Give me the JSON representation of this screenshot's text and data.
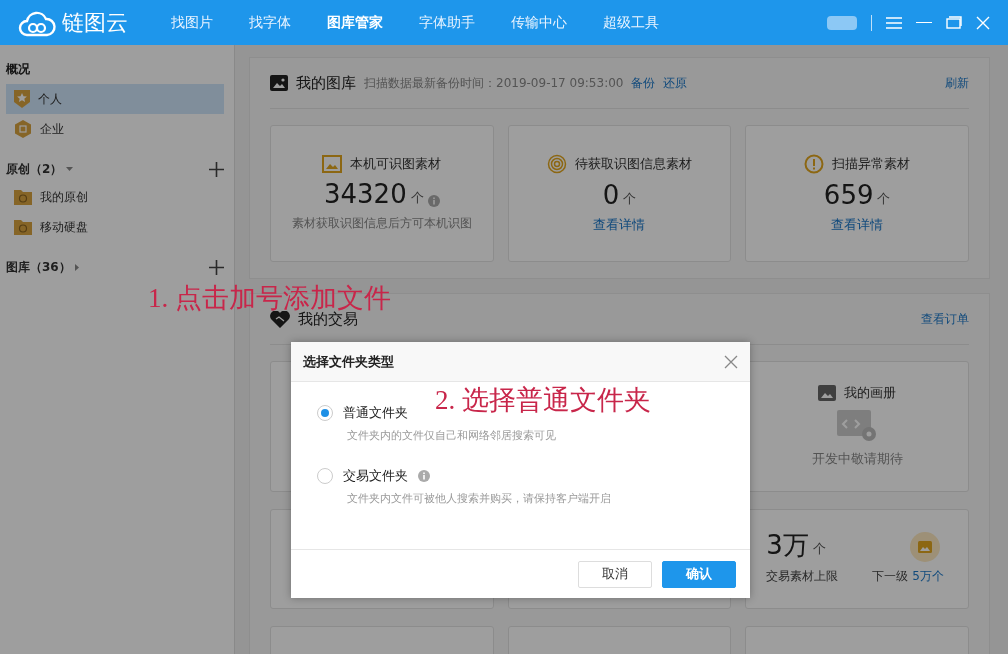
{
  "topbar": {
    "logo": "链图云",
    "nav": [
      {
        "label": "找图片",
        "selected": false
      },
      {
        "label": "找字体",
        "selected": false
      },
      {
        "label": "图库管家",
        "selected": true
      },
      {
        "label": "字体助手",
        "selected": false
      },
      {
        "label": "传输中心",
        "selected": false
      },
      {
        "label": "超级工具",
        "selected": false
      }
    ]
  },
  "sidebar": {
    "overview": {
      "title": "概况",
      "items": [
        {
          "label": "个人",
          "selected": true
        },
        {
          "label": "企业",
          "selected": false
        }
      ]
    },
    "groups": [
      {
        "label": "原创（2）",
        "expanded": true,
        "children": [
          {
            "label": "我的原创"
          },
          {
            "label": "移动硬盘"
          }
        ]
      },
      {
        "label": "图库（36）",
        "expanded": false
      }
    ]
  },
  "library": {
    "title": "我的图库",
    "subtitle": "扫描数据最新备份时间：2019-09-17 09:53:00",
    "links": [
      "备份",
      "还原"
    ],
    "refresh": "刷新",
    "cards": [
      {
        "kind": "note",
        "title": "本机可识图素材",
        "value": "34320",
        "unit": "个",
        "note": "素材获取识图信息后方可本机识图"
      },
      {
        "kind": "link",
        "title": "待获取识图信息素材",
        "value": "0",
        "unit": "个",
        "link": "查看详情"
      },
      {
        "kind": "link",
        "title": "扫描异常素材",
        "value": "659",
        "unit": "个",
        "link": "查看详情"
      }
    ]
  },
  "trade": {
    "title": "我的交易",
    "link": "查看订单",
    "album": {
      "title": "我的画册",
      "note": "开发中敬请期待"
    },
    "quota": {
      "value": "3万",
      "unit": "个",
      "label": "交易素材上限",
      "next_label": "下一级",
      "next_link": "5万个"
    }
  },
  "dialog": {
    "title": "选择文件夹类型",
    "options": [
      {
        "label": "普通文件夹",
        "description": "文件夹内的文件仅自己和网络邻居搜索可见",
        "selected": true,
        "info_icon": false
      },
      {
        "label": "交易文件夹",
        "description": "文件夹内文件可被他人搜索并购买，请保持客户端开启",
        "selected": false,
        "info_icon": true
      }
    ],
    "buttons": [
      {
        "label": "取消",
        "kind": "secondary"
      },
      {
        "label": "确认",
        "kind": "primary"
      }
    ]
  },
  "annotations": [
    {
      "text": "1. 点击加号添加文件"
    },
    {
      "text": "2. 选择普通文件夹"
    }
  ]
}
